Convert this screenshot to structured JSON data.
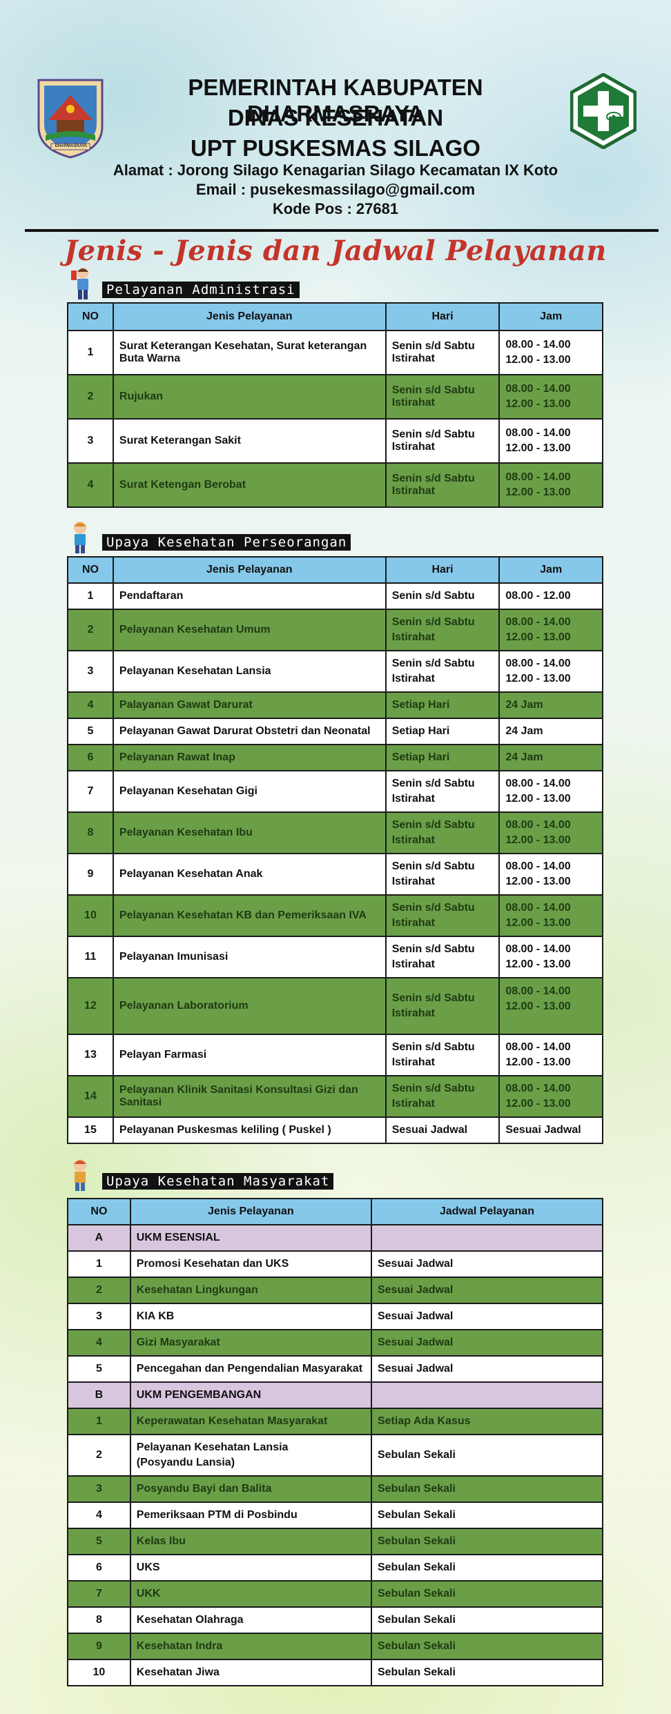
{
  "header": {
    "line1": "PEMERINTAH KABUPATEN DHARMASRAYA",
    "line2": "DINAS KESEHATAN",
    "line3": "UPT PUSKESMAS SILAGO",
    "address": "Alamat  : Jorong Silago Kenagarian Silago Kecamatan IX Koto",
    "email": "Email : pusekesmassilago@gmail.com",
    "postal": "Kode Pos : 27681",
    "logo_left_text": "DHARMASRAYA"
  },
  "main_title": "Jenis - Jenis dan Jadwal Pelayanan",
  "colors": {
    "green_row": "#6a9f48",
    "header_blue": "#86c8ea",
    "purple_row": "#d8c6de",
    "title_red": "#c4342a"
  },
  "section1": {
    "label": "Pelayanan Administrasi",
    "headers": [
      "NO",
      "Jenis Pelayanan",
      "Hari",
      "Jam"
    ],
    "rows": [
      {
        "no": "1",
        "jenis": "Surat Keterangan Kesehatan, Surat keterangan Buta Warna",
        "hari": "Senin s/d Sabtu Istirahat",
        "jam1": "08.00 - 14.00",
        "jam2": "12.00 - 13.00"
      },
      {
        "no": "2",
        "jenis": "Rujukan",
        "hari": "Senin s/d Sabtu Istirahat",
        "jam1": "08.00 - 14.00",
        "jam2": "12.00 - 13.00"
      },
      {
        "no": "3",
        "jenis": "Surat Keterangan Sakit",
        "hari": "Senin s/d Sabtu Istirahat",
        "jam1": "08.00 - 14.00",
        "jam2": "12.00 - 13.00"
      },
      {
        "no": "4",
        "jenis": "Surat Ketengan Berobat",
        "hari": "Senin s/d Sabtu Istirahat",
        "jam1": "08.00 - 14.00",
        "jam2": "12.00 - 13.00"
      }
    ]
  },
  "section2": {
    "label": "Upaya Kesehatan Perseorangan",
    "headers": [
      "NO",
      "Jenis Pelayanan",
      "Hari",
      "Jam"
    ],
    "rows": [
      {
        "no": "1",
        "jenis": "Pendaftaran",
        "hari1": "Senin s/d Sabtu",
        "hari2": "",
        "jam1": "08.00 - 12.00",
        "jam2": ""
      },
      {
        "no": "2",
        "jenis": "Pelayanan Kesehatan Umum",
        "hari1": "Senin s/d Sabtu",
        "hari2": "Istirahat",
        "jam1": "08.00 - 14.00",
        "jam2": "12.00 - 13.00"
      },
      {
        "no": "3",
        "jenis": "Pelayanan Kesehatan Lansia",
        "hari1": "Senin s/d Sabtu",
        "hari2": "Istirahat",
        "jam1": "08.00 - 14.00",
        "jam2": "12.00 - 13.00"
      },
      {
        "no": "4",
        "jenis": "Palayanan Gawat Darurat",
        "hari1": "Setiap Hari",
        "hari2": "",
        "jam1": "24 Jam",
        "jam2": ""
      },
      {
        "no": "5",
        "jenis": "Pelayanan Gawat Darurat Obstetri dan Neonatal",
        "hari1": "Setiap Hari",
        "hari2": "",
        "jam1": "24 Jam",
        "jam2": ""
      },
      {
        "no": "6",
        "jenis": "Pelayanan Rawat Inap",
        "hari1": "Setiap Hari",
        "hari2": "",
        "jam1": "24 Jam",
        "jam2": ""
      },
      {
        "no": "7",
        "jenis": "Pelayanan Kesehatan Gigi",
        "hari1": "Senin s/d Sabtu",
        "hari2": "Istirahat",
        "jam1": "08.00 - 14.00",
        "jam2": "12.00 - 13.00"
      },
      {
        "no": "8",
        "jenis": "Pelayanan Kesehatan Ibu",
        "hari1": "Senin s/d Sabtu",
        "hari2": "Istirahat",
        "jam1": "08.00 - 14.00",
        "jam2": "12.00 - 13.00"
      },
      {
        "no": "9",
        "jenis": "Pelayanan Kesehatan Anak",
        "hari1": "Senin s/d Sabtu",
        "hari2": "Istirahat",
        "jam1": "08.00 - 14.00",
        "jam2": "12.00 - 13.00"
      },
      {
        "no": "10",
        "jenis": "Pelayanan Kesehatan KB dan Pemeriksaan IVA",
        "hari1": "Senin s/d Sabtu",
        "hari2": "Istirahat",
        "jam1": "08.00 - 14.00",
        "jam2": "12.00 - 13.00"
      },
      {
        "no": "11",
        "jenis": "Pelayanan Imunisasi",
        "hari1": "Senin s/d Sabtu",
        "hari2": "Istirahat",
        "jam1": "08.00 - 14.00",
        "jam2": "12.00 - 13.00"
      },
      {
        "no": "12",
        "jenis": "Pelayanan Laboratorium",
        "hari1": "Senin s/d Sabtu",
        "hari2": "Istirahat",
        "jam1": "08.00 - 14.00",
        "jam2": "12.00 - 13.00"
      },
      {
        "no": "13",
        "jenis": "Pelayan Farmasi",
        "hari1": "Senin s/d Sabtu",
        "hari2": "Istirahat",
        "jam1": "08.00 - 14.00",
        "jam2": "12.00 - 13.00"
      },
      {
        "no": "14",
        "jenis": "Pelayanan Klinik Sanitasi Konsultasi Gizi dan Sanitasi",
        "hari1": "Senin s/d Sabtu",
        "hari2": "Istirahat",
        "jam1": "08.00 - 14.00",
        "jam2": "12.00 - 13.00"
      },
      {
        "no": "15",
        "jenis": "Pelayanan Puskesmas keliling ( Puskel )",
        "hari1": "Sesuai Jadwal",
        "hari2": "",
        "jam1": "Sesuai Jadwal",
        "jam2": ""
      }
    ]
  },
  "section3": {
    "label": "Upaya Kesehatan Masyarakat",
    "headers": [
      "NO",
      "Jenis Pelayanan",
      "Jadwal Pelayanan"
    ],
    "rows": [
      {
        "no": "A",
        "jenis": "UKM ESENSIAL",
        "jadwal": ""
      },
      {
        "no": "1",
        "jenis": "Promosi Kesehatan dan UKS",
        "jadwal": "Sesuai Jadwal"
      },
      {
        "no": "2",
        "jenis": "Kesehatan Lingkungan",
        "jadwal": "Sesuai Jadwal"
      },
      {
        "no": "3",
        "jenis": "KIA KB",
        "jadwal": "Sesuai Jadwal"
      },
      {
        "no": "4",
        "jenis": "Gizi Masyarakat",
        "jadwal": "Sesuai Jadwal"
      },
      {
        "no": "5",
        "jenis": "Pencegahan dan Pengendalian Masyarakat",
        "jadwal": "Sesuai Jadwal"
      },
      {
        "no": "B",
        "jenis": "UKM PENGEMBANGAN",
        "jadwal": ""
      },
      {
        "no": "1",
        "jenis": "Keperawatan Kesehatan Masyarakat",
        "jadwal": "Setiap Ada Kasus"
      },
      {
        "no": "2",
        "jenis": "Pelayanan Kesehatan Lansia",
        "jenis2": "(Posyandu Lansia)",
        "jadwal": "Sebulan Sekali"
      },
      {
        "no": "3",
        "jenis": "Posyandu Bayi dan Balita",
        "jadwal": "Sebulan Sekali"
      },
      {
        "no": "4",
        "jenis": "Pemeriksaan PTM di Posbindu",
        "jadwal": "Sebulan Sekali"
      },
      {
        "no": "5",
        "jenis": "Kelas Ibu",
        "jadwal": "Sebulan Sekali"
      },
      {
        "no": "6",
        "jenis": "UKS",
        "jadwal": "Sebulan Sekali"
      },
      {
        "no": "7",
        "jenis": "UKK",
        "jadwal": "Sebulan Sekali"
      },
      {
        "no": "8",
        "jenis": "Kesehatan Olahraga",
        "jadwal": "Sebulan Sekali"
      },
      {
        "no": "9",
        "jenis": "Kesehatan Indra",
        "jadwal": "Sebulan Sekali"
      },
      {
        "no": "10",
        "jenis": "Kesehatan Jiwa",
        "jadwal": "Sebulan Sekali"
      }
    ]
  }
}
